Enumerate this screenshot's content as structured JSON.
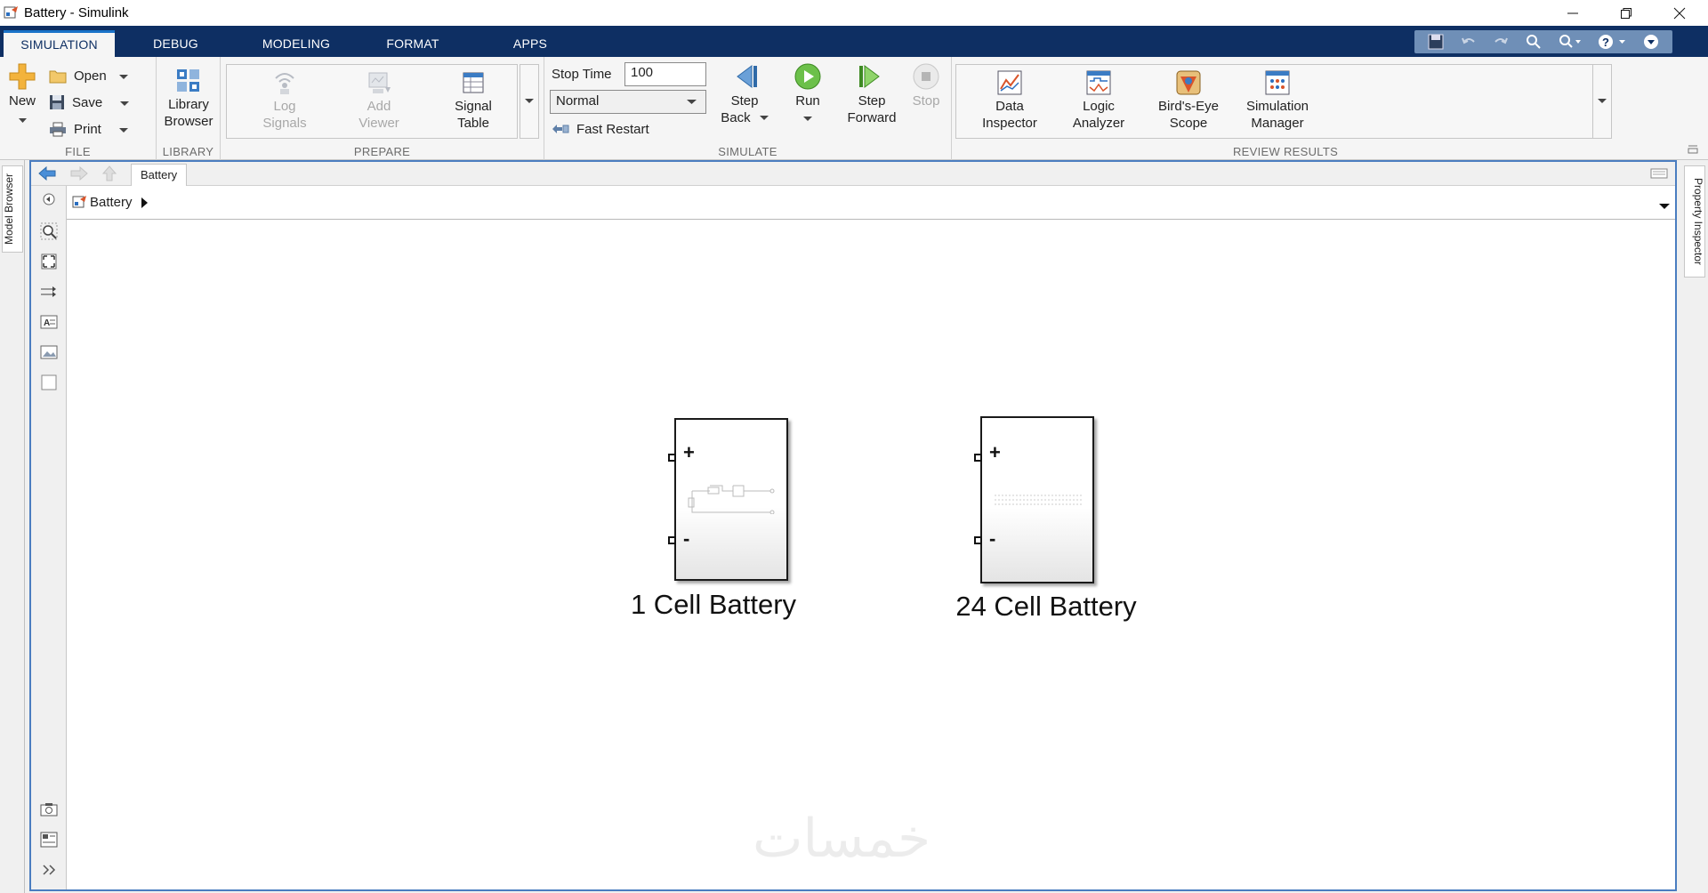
{
  "window": {
    "title": "Battery - Simulink",
    "controls": [
      "minimize",
      "restore",
      "close"
    ]
  },
  "tabs": [
    {
      "label": "SIMULATION",
      "active": true
    },
    {
      "label": "DEBUG",
      "active": false
    },
    {
      "label": "MODELING",
      "active": false
    },
    {
      "label": "FORMAT",
      "active": false
    },
    {
      "label": "APPS",
      "active": false
    }
  ],
  "toolstrip": {
    "file": {
      "section_label": "FILE",
      "new": "New",
      "open": "Open",
      "save": "Save",
      "print": "Print"
    },
    "library": {
      "section_label": "LIBRARY",
      "browser_line1": "Library",
      "browser_line2": "Browser"
    },
    "prepare": {
      "section_label": "PREPARE",
      "log_signals_1": "Log",
      "log_signals_2": "Signals",
      "add_viewer_1": "Add",
      "add_viewer_2": "Viewer",
      "signal_table_1": "Signal",
      "signal_table_2": "Table"
    },
    "simulate": {
      "section_label": "SIMULATE",
      "stop_time_label": "Stop Time",
      "stop_time_value": "100",
      "mode_value": "Normal",
      "fast_restart": "Fast Restart",
      "step_back_1": "Step",
      "step_back_2": "Back",
      "run": "Run",
      "step_forward_1": "Step",
      "step_forward_2": "Forward",
      "stop": "Stop"
    },
    "review": {
      "section_label": "REVIEW RESULTS",
      "data_inspector_1": "Data",
      "data_inspector_2": "Inspector",
      "logic_analyzer_1": "Logic",
      "logic_analyzer_2": "Analyzer",
      "birds_eye_1": "Bird's-Eye",
      "birds_eye_2": "Scope",
      "sim_manager_1": "Simulation",
      "sim_manager_2": "Manager"
    }
  },
  "side_tabs": {
    "left": "Model Browser",
    "right": "Property Inspector"
  },
  "editor": {
    "model_tab": "Battery",
    "breadcrumb": "Battery"
  },
  "canvas": {
    "blocks": [
      {
        "name": "1 Cell Battery",
        "port_plus": "+",
        "port_minus": "-"
      },
      {
        "name": "24 Cell Battery",
        "port_plus": "+",
        "port_minus": "-"
      }
    ],
    "watermark": "خمسات"
  },
  "colors": {
    "tab_bar": "#0e2f63",
    "accent": "#1a73c9",
    "editor_border": "#4a7dc0"
  }
}
